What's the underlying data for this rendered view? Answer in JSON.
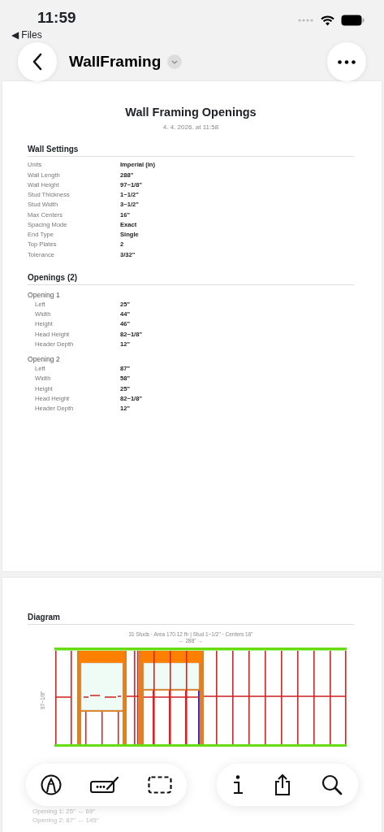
{
  "status_bar": {
    "time": "11:59",
    "back_app": "◀ Files"
  },
  "nav": {
    "title": "WallFraming"
  },
  "document": {
    "title": "Wall Framing Openings",
    "date": "4. 4. 2026. at 11:58",
    "settings_heading": "Wall Settings",
    "settings": [
      {
        "label": "Units",
        "value": "Imperial (in)"
      },
      {
        "label": "Wall Length",
        "value": "288\""
      },
      {
        "label": "Wall Height",
        "value": "97~1/8\""
      },
      {
        "label": "Stud Thickness",
        "value": "1~1/2\""
      },
      {
        "label": "Stud Width",
        "value": "3~1/2\""
      },
      {
        "label": "Max Centers",
        "value": "16\""
      },
      {
        "label": "Spacing Mode",
        "value": "Exact"
      },
      {
        "label": "End Type",
        "value": "Single"
      },
      {
        "label": "Top Plates",
        "value": "2"
      },
      {
        "label": "Tolerance",
        "value": "3/32\""
      }
    ],
    "openings_heading": "Openings (2)",
    "openings": [
      {
        "name": "Opening 1",
        "fields": [
          {
            "label": "Left",
            "value": "25\""
          },
          {
            "label": "Width",
            "value": "44\""
          },
          {
            "label": "Height",
            "value": "46\""
          },
          {
            "label": "Head Height",
            "value": "82~1/8\""
          },
          {
            "label": "Header Depth",
            "value": "12\""
          }
        ]
      },
      {
        "name": "Opening 2",
        "fields": [
          {
            "label": "Left",
            "value": "87\""
          },
          {
            "label": "Width",
            "value": "58\""
          },
          {
            "label": "Height",
            "value": "25\""
          },
          {
            "label": "Head Height",
            "value": "82~1/8\""
          },
          {
            "label": "Header Depth",
            "value": "12\""
          }
        ]
      }
    ]
  },
  "page2": {
    "diagram_heading": "Diagram",
    "caption": "31 Studs · Area 170.12 ft² | Stud 1~1/2\" · Centers 16\"",
    "length_label": "← 288\" →",
    "height_label": "97~1/8\"",
    "results_lines": [
      "Opening 1: 25\" ↔ 69\"",
      "Opening 2: 87\" ↔ 145\""
    ]
  }
}
